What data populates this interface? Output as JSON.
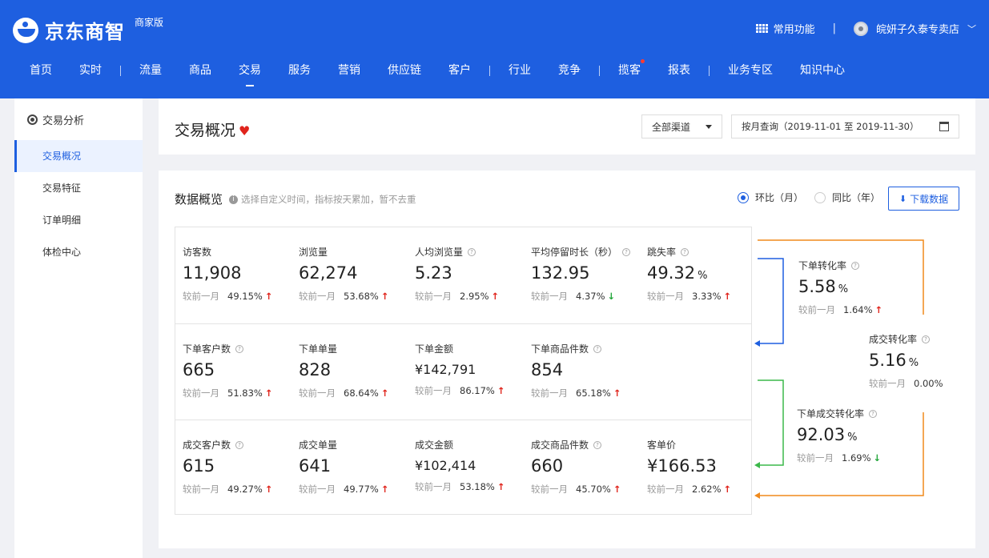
{
  "header": {
    "logo_text": "京东商智",
    "edition": "商家版",
    "common_functions": "常用功能",
    "separator": "|",
    "shop_name": "皖妍子久泰专卖店"
  },
  "nav": [
    "首页",
    "实时",
    "流量",
    "商品",
    "交易",
    "服务",
    "营销",
    "供应链",
    "客户",
    "行业",
    "竞争",
    "揽客",
    "报表",
    "业务专区",
    "知识中心"
  ],
  "sidebar": {
    "section_title": "交易分析",
    "items": [
      "交易概况",
      "交易特征",
      "订单明细",
      "体检中心"
    ]
  },
  "title_card": {
    "title": "交易概况",
    "channel": "全部渠道",
    "date_range": "按月查询（2019-11-01 至 2019-11-30）"
  },
  "data_card": {
    "title": "数据概览",
    "hint": "选择自定义时间，指标按天累加，暂不去重",
    "radio_mom": "环比（月）",
    "radio_yoy": "同比（年）",
    "download": "下载数据",
    "compare_label": "较前一月",
    "rows": [
      [
        {
          "label": "访客数",
          "value": "11,908",
          "pct": "49.15%",
          "dir": "up",
          "help": false,
          "unit": ""
        },
        {
          "label": "浏览量",
          "value": "62,274",
          "pct": "53.68%",
          "dir": "up",
          "help": false,
          "unit": ""
        },
        {
          "label": "人均浏览量",
          "value": "5.23",
          "pct": "2.95%",
          "dir": "up",
          "help": true,
          "unit": ""
        },
        {
          "label": "平均停留时长（秒）",
          "value": "132.95",
          "pct": "4.37%",
          "dir": "down",
          "help": true,
          "unit": ""
        },
        {
          "label": "跳失率",
          "value": "49.32",
          "pct": "3.33%",
          "dir": "up",
          "help": true,
          "unit": "%"
        }
      ],
      [
        {
          "label": "下单客户数",
          "value": "665",
          "pct": "51.83%",
          "dir": "up",
          "help": true,
          "unit": ""
        },
        {
          "label": "下单单量",
          "value": "828",
          "pct": "68.64%",
          "dir": "up",
          "help": false,
          "unit": ""
        },
        {
          "label": "下单金额",
          "value": "¥142,791",
          "pct": "86.17%",
          "dir": "up",
          "help": false,
          "unit": "",
          "small": true
        },
        {
          "label": "下单商品件数",
          "value": "854",
          "pct": "65.18%",
          "dir": "up",
          "help": true,
          "unit": ""
        }
      ],
      [
        {
          "label": "成交客户数",
          "value": "615",
          "pct": "49.27%",
          "dir": "up",
          "help": true,
          "unit": ""
        },
        {
          "label": "成交单量",
          "value": "641",
          "pct": "49.77%",
          "dir": "up",
          "help": false,
          "unit": ""
        },
        {
          "label": "成交金额",
          "value": "¥102,414",
          "pct": "53.18%",
          "dir": "up",
          "help": false,
          "unit": "",
          "small": true
        },
        {
          "label": "成交商品件数",
          "value": "660",
          "pct": "45.70%",
          "dir": "up",
          "help": true,
          "unit": ""
        },
        {
          "label": "客单价",
          "value": "¥166.53",
          "pct": "2.62%",
          "dir": "up",
          "help": false,
          "unit": ""
        }
      ]
    ],
    "funnel": [
      {
        "label": "下单转化率",
        "value": "5.58",
        "unit": "%",
        "pct": "1.64%",
        "dir": "up"
      },
      {
        "label": "成交转化率",
        "value": "5.16",
        "unit": "%",
        "pct": "0.00%",
        "dir": "none"
      },
      {
        "label": "下单成交转化率",
        "value": "92.03",
        "unit": "%",
        "pct": "1.69%",
        "dir": "down"
      }
    ]
  },
  "colors": {
    "brand": "#1e5fe0",
    "up": "#e0241c",
    "down": "#22a63a",
    "funnel_blue": "#1e5fe0",
    "funnel_green": "#3bb84a",
    "funnel_orange": "#f08a1c"
  }
}
